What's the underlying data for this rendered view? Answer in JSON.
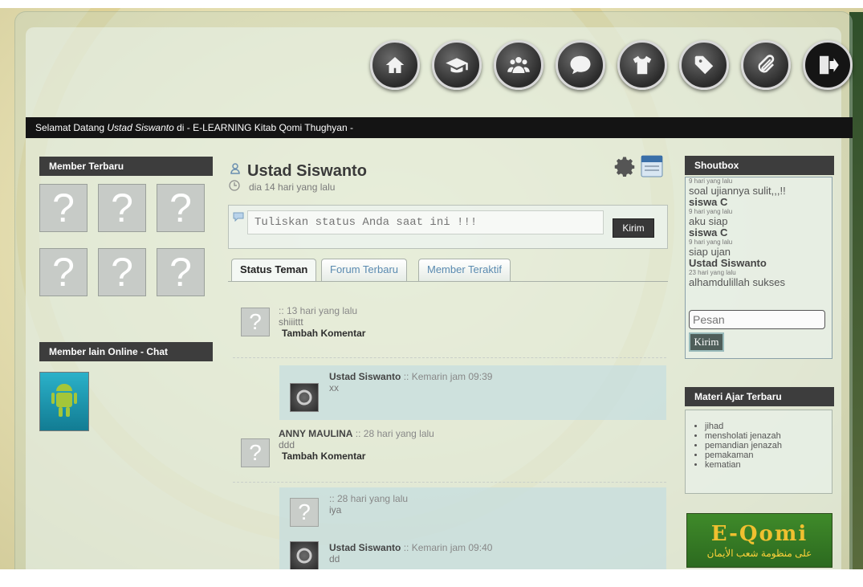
{
  "nav": {
    "items": [
      {
        "name": "home",
        "icon": "home-icon"
      },
      {
        "name": "courses",
        "icon": "graduation-cap-icon"
      },
      {
        "name": "members",
        "icon": "users-icon"
      },
      {
        "name": "chat",
        "icon": "speech-bubble-icon"
      },
      {
        "name": "shirt",
        "icon": "shirt-icon"
      },
      {
        "name": "tag",
        "icon": "tag-icon"
      },
      {
        "name": "attachment",
        "icon": "paperclip-icon"
      },
      {
        "name": "logout",
        "icon": "logout-icon"
      }
    ]
  },
  "welcome": {
    "prefix": "Selamat Datang ",
    "user": "Ustad Siswanto",
    "suffix": " di - E-LEARNING Kitab Qomi Thughyan -"
  },
  "left": {
    "member_terbaru_title": "Member Terbaru",
    "unknown_glyph": "?",
    "online_title": "Member lain Online - Chat"
  },
  "profile": {
    "name": "Ustad Siswanto",
    "time": "dia 14 hari yang lalu"
  },
  "status": {
    "placeholder": "Tuliskan status Anda saat ini !!!",
    "submit_label": "Kirim"
  },
  "tabs": [
    "Status Teman",
    "Forum Terbaru",
    "Member Teraktif"
  ],
  "posts": [
    {
      "author": "",
      "time": ":: 13 hari yang lalu",
      "body": "shiiittt",
      "add_comment": "Tambah Komentar"
    },
    {
      "author": "Ustad Siswanto",
      "time": " :: Kemarin jam 09:39",
      "body": "xx"
    },
    {
      "author": "ANNY MAULINA",
      "time": " :: 28 hari yang lalu",
      "body": "ddd",
      "add_comment": "Tambah Komentar"
    },
    {
      "author": "",
      "time": ":: 28 hari yang lalu",
      "body": "iya"
    },
    {
      "author": "Ustad Siswanto",
      "time": " :: Kemarin jam 09:40",
      "body": "dd"
    }
  ],
  "shoutbox": {
    "title": "Shoutbox",
    "entries": [
      {
        "time": "9 hari yang lalu",
        "msg": "soal ujiannya sulit,,,!!"
      },
      {
        "name": "siswa C",
        "time": "9 hari yang lalu",
        "msg": "aku siap"
      },
      {
        "name": "siswa C",
        "time": "9 hari yang lalu",
        "msg": "siap ujan"
      },
      {
        "name": "Ustad Siswanto",
        "time": "23 hari yang lalu",
        "msg": "alhamdulillah sukses"
      }
    ],
    "input_placeholder": "Pesan",
    "submit_label": "Kirim"
  },
  "materi": {
    "title": "Materi Ajar Terbaru",
    "items": [
      "jihad",
      "mensholati jenazah",
      "pemandian jenazah",
      "pemakaman",
      "kematian"
    ]
  },
  "banner": {
    "logo": "E-Qomi",
    "subtitle": "على منظومة شعب الأيمان"
  },
  "colors": {
    "nav_button": "#2b2b2b",
    "header_bar": "#141414",
    "link": "#5a8ab0"
  }
}
